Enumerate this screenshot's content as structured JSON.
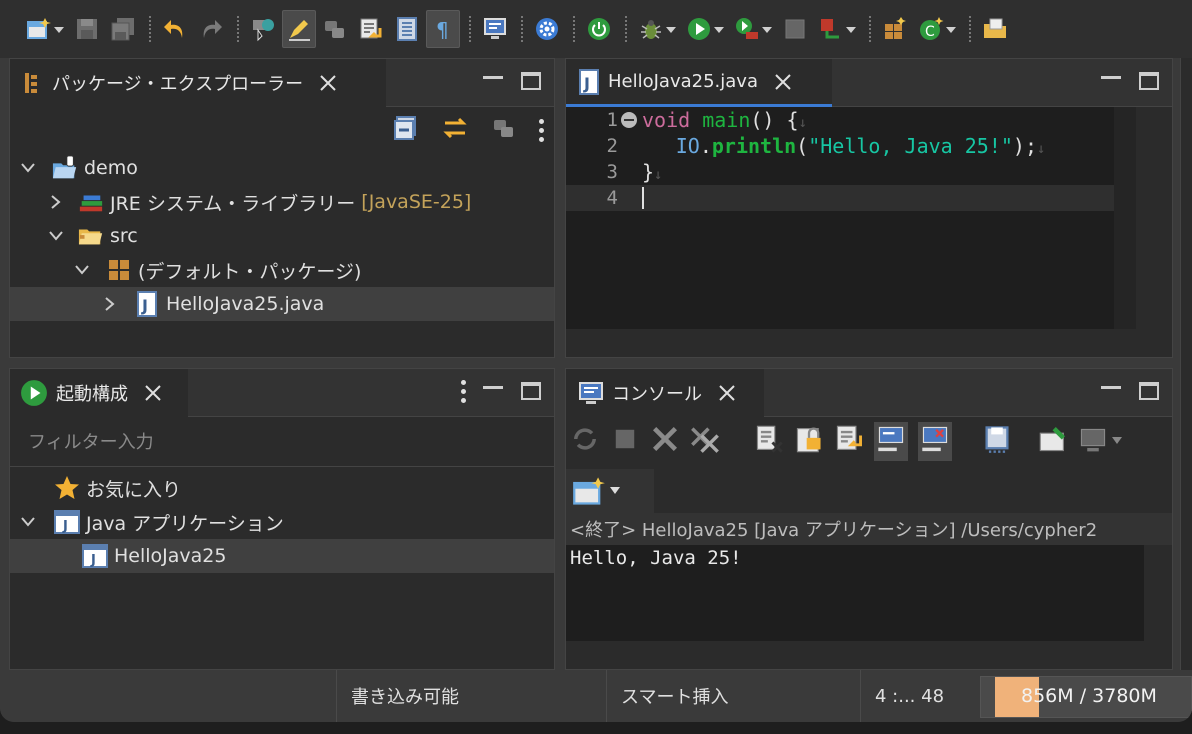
{
  "package_explorer": {
    "title": "パッケージ・エクスプローラー",
    "tree": {
      "project": "demo",
      "jre": "JRE システム・ライブラリー",
      "jre_decoration": "[JavaSE-25]",
      "src": "src",
      "package": "(デフォルト・パッケージ)",
      "file": "HelloJava25.java"
    }
  },
  "editor": {
    "tab_label": "HelloJava25.java",
    "lines": [
      {
        "num": "1"
      },
      {
        "num": "2"
      },
      {
        "num": "3"
      },
      {
        "num": "4"
      }
    ],
    "code": {
      "l1_kw": "void",
      "l1_fn": "main",
      "l1_rest": "() {",
      "l2_type": "IO",
      "l2_dot": ".",
      "l2_fn": "println",
      "l2_open": "(",
      "l2_str": "\"Hello, Java 25!\"",
      "l2_close": ");",
      "l3": "}"
    }
  },
  "launch_config": {
    "title": "起動構成",
    "filter_placeholder": "フィルター入力",
    "favorites": "お気に入り",
    "java_app": "Java アプリケーション",
    "config_item": "HelloJava25"
  },
  "console": {
    "title": "コンソール",
    "terminated_line": "<終了> HelloJava25 [Java アプリケーション] /Users/cypher2",
    "output": "Hello, Java 25!"
  },
  "statusbar": {
    "writable": "書き込み可能",
    "insert_mode": "スマート挿入",
    "position": "4 :... 48",
    "heap": "856M / 3780M",
    "heap_used_fraction": 0.226
  },
  "colors": {
    "keyword": "#cc6c9c",
    "method": "#1eb540",
    "string": "#17c6a3",
    "type": "#6aa9e0",
    "heap_bar": "#f0b27a",
    "active_tab_underline": "#3b7bd4"
  }
}
